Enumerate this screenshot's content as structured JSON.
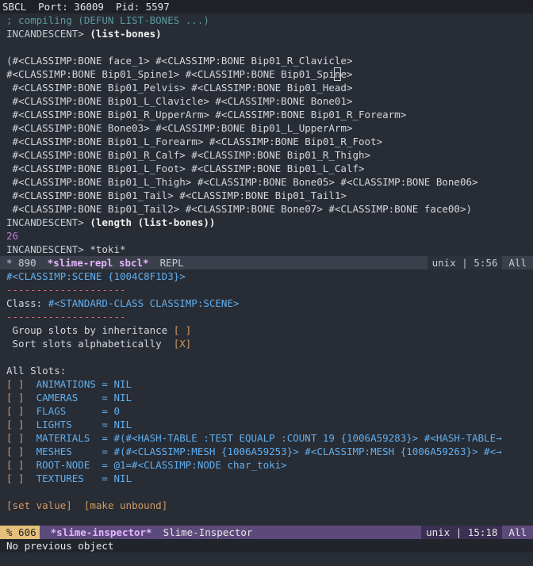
{
  "header": {
    "text": "SBCL  Port: 36009  Pid: 5597"
  },
  "repl": {
    "compiling": "; compiling (DEFUN LIST-BONES ...)",
    "prompt": "INCANDESCENT> ",
    "cmd1": "(list-bones)",
    "out": [
      "(#<CLASSIMP:BONE face_1> #<CLASSIMP:BONE Bip01_R_Clavicle>",
      " #<CLASSIMP:BONE Bip01_Spine1> #<CLASSIMP:BONE Bip01_Spine>",
      " #<CLASSIMP:BONE Bip01_Pelvis> #<CLASSIMP:BONE Bip01_Head>",
      " #<CLASSIMP:BONE Bip01_L_Clavicle> #<CLASSIMP:BONE Bone01>",
      " #<CLASSIMP:BONE Bip01_R_UpperArm> #<CLASSIMP:BONE Bip01_R_Forearm>",
      " #<CLASSIMP:BONE Bone03> #<CLASSIMP:BONE Bip01_L_UpperArm>",
      " #<CLASSIMP:BONE Bip01_L_Forearm> #<CLASSIMP:BONE Bip01_R_Foot>",
      " #<CLASSIMP:BONE Bip01_R_Calf> #<CLASSIMP:BONE Bip01_R_Thigh>",
      " #<CLASSIMP:BONE Bip01_L_Foot> #<CLASSIMP:BONE Bip01_L_Calf>",
      " #<CLASSIMP:BONE Bip01_L_Thigh> #<CLASSIMP:BONE Bone05> #<CLASSIMP:BONE Bone06>",
      " #<CLASSIMP:BONE Bip01_Tail> #<CLASSIMP:BONE Bip01_Tail1>",
      " #<CLASSIMP:BONE Bip01_Tail2> #<CLASSIMP:BONE Bone07> #<CLASSIMP:BONE face00>)"
    ],
    "cmd2": "(length (list-bones))",
    "result2": "26",
    "cmd3": "*toki*"
  },
  "modeline1": {
    "state": "* 890",
    "buffer": "*slime-repl sbcl*",
    "mode": "REPL",
    "encoding": "unix | 5:56",
    "position": "All"
  },
  "inspector": {
    "title": "#<CLASSIMP:SCENE {1004C8F1D3}>",
    "divider": "--------------------",
    "class_label": "Class: ",
    "class_value": "#<STANDARD-CLASS CLASSIMP:SCENE>",
    "group_label": " Group slots by inheritance ",
    "group_box": "[ ]",
    "sort_label": " Sort slots alphabetically  ",
    "sort_box": "[X]",
    "all_slots": "All Slots:",
    "slots": [
      {
        "box": "[ ]",
        "name": "  ANIMATIONS = ",
        "value": "NIL"
      },
      {
        "box": "[ ]",
        "name": "  CAMERAS    = ",
        "value": "NIL"
      },
      {
        "box": "[ ]",
        "name": "  FLAGS      = ",
        "value": "0"
      },
      {
        "box": "[ ]",
        "name": "  LIGHTS     = ",
        "value": "NIL"
      },
      {
        "box": "[ ]",
        "name": "  MATERIALS  = ",
        "value": "#(#<HASH-TABLE :TEST EQUALP :COUNT 19 {1006A59283}> #<HASH-TABLE→"
      },
      {
        "box": "[ ]",
        "name": "  MESHES     = ",
        "value": "#(#<CLASSIMP:MESH {1006A59253}> #<CLASSIMP:MESH {1006A59263}> #<→"
      },
      {
        "box": "[ ]",
        "name": "  ROOT-NODE  = ",
        "value": "@1=#<CLASSIMP:NODE char_toki>"
      },
      {
        "box": "[ ]",
        "name": "  TEXTURES   = ",
        "value": "NIL"
      }
    ],
    "set_value": "[set value]",
    "make_unbound": "[make unbound]"
  },
  "modeline2": {
    "state": "% 606",
    "buffer": "*slime-inspector*",
    "mode": "Slime-Inspector",
    "encoding": "unix | 15:18",
    "position": "All"
  },
  "echo": "No previous object"
}
